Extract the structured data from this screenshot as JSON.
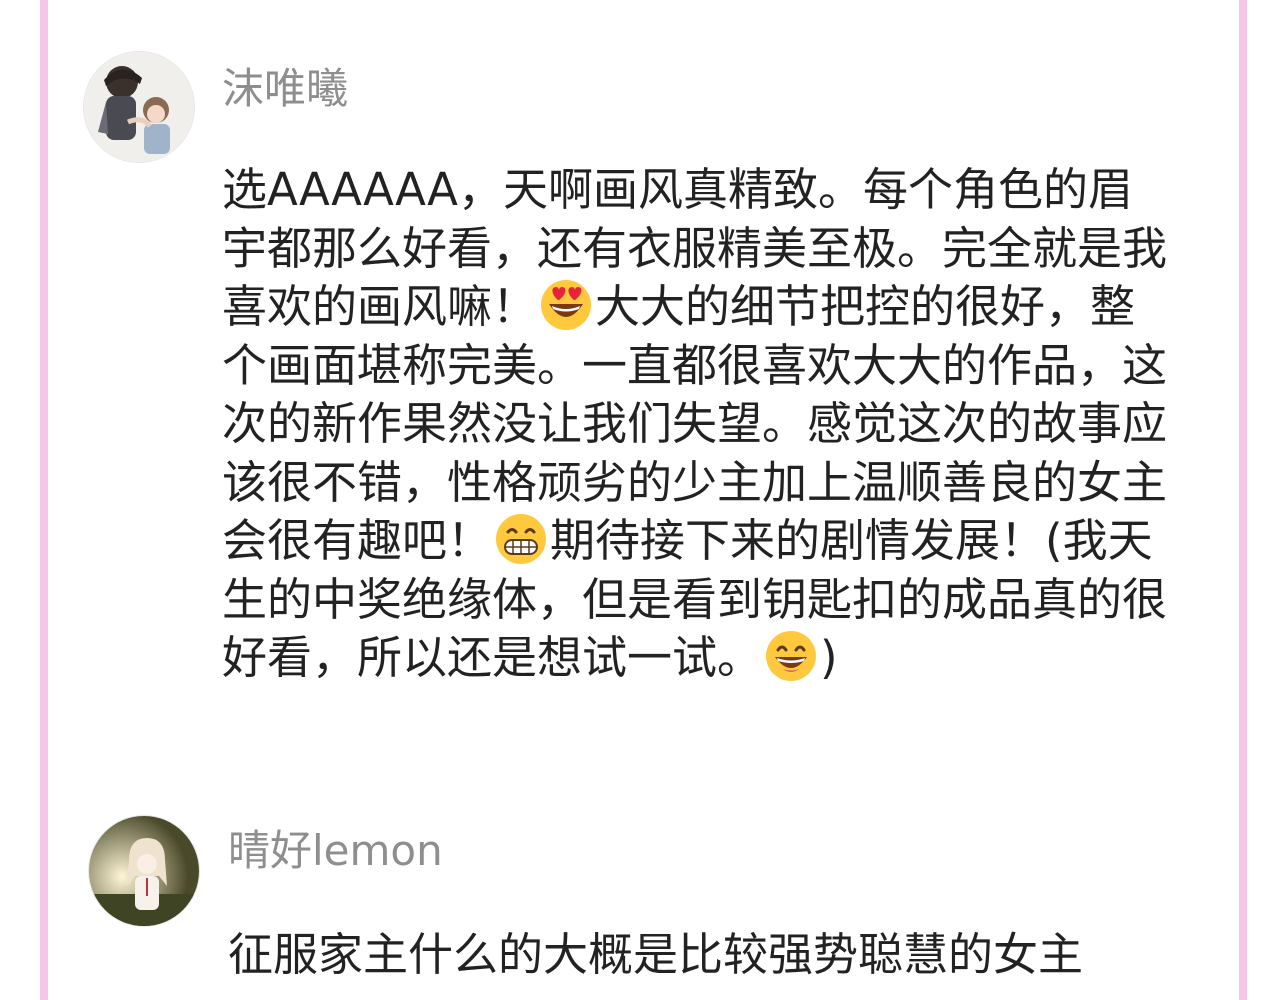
{
  "comments": [
    {
      "username": "沫唯曦",
      "segments": [
        "选AAAAAA，天啊画风真精致。每个角色的眉宇都那么好看，还有衣服精美至极。完全就是我喜欢的画风嘛！",
        "大大的细节把控的很好，整个画面堪称完美。一直都很喜欢大大的作品，这次的新作果然没让我们失望。感觉这次的故事应该很不错，性格顽劣的少主加上温顺善良的女主会很有趣吧！",
        "期待接下来的剧情发展！(我天生的中奖绝缘体，但是看到钥匙扣的成品真的很好看，所以还是想试一试。",
        ")"
      ],
      "emojis": [
        "heart-eyes-emoji",
        "grin-emoji",
        "smile-emoji"
      ]
    },
    {
      "username": "晴好lemon",
      "segments": [
        "征服家主什么的大概是比较强势聪慧的女主"
      ]
    }
  ],
  "colors": {
    "frame": "#f3c8e6",
    "username": "#8e8e8e",
    "text": "#222222",
    "emoji_face": "#ffc83d"
  }
}
